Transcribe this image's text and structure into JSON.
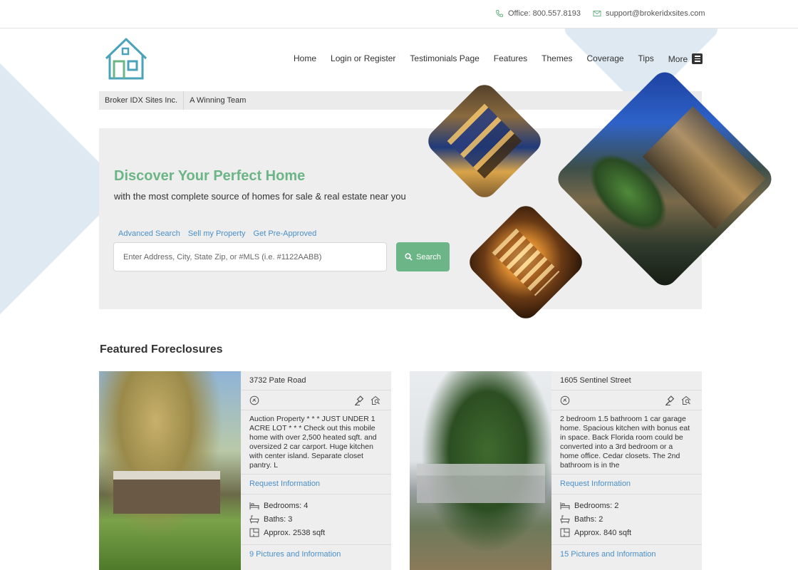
{
  "topbar": {
    "office": "Office: 800.557.8193",
    "email": "support@brokeridxsites.com"
  },
  "logo": {
    "icon": "house-logo-icon",
    "color": "#4aa3b8"
  },
  "nav": {
    "items": [
      "Home",
      "Login or Register",
      "Testimonials Page",
      "Features",
      "Themes",
      "Coverage",
      "Tips"
    ],
    "more": "More"
  },
  "crumbbar": {
    "company": "Broker IDX Sites Inc.",
    "tagline": "A Winning Team"
  },
  "hero": {
    "title": "Discover Your Perfect Home",
    "subtitle": "with the most complete source of homes for sale & real estate near you",
    "links": [
      "Advanced Search",
      "Sell my Property",
      "Get Pre-Approved"
    ],
    "search_placeholder": "Enter Address, City, State Zip, or #MLS (i.e. #1122AABB)",
    "search_button": "Search",
    "accent_color": "#6cb586"
  },
  "featured": {
    "title": "Featured Foreclosures",
    "listings": [
      {
        "address": "3732 Pate Road",
        "description": "Auction Property * * * JUST UNDER 1 ACRE LOT * * * Check out this mobile home with over 2,500 heated sqft. and oversized 2 car carport. Huge kitchen with center island. Separate closet pantry. L",
        "request": "Request Information",
        "bedrooms": "Bedrooms: 4",
        "baths": "Baths: 3",
        "sqft": "Approx. 2538 sqft",
        "pictures": "9 Pictures and Information"
      },
      {
        "address": "1605 Sentinel Street",
        "description": "2 bedroom 1.5 bathroom 1 car garage home. Spacious kitchen with bonus eat in space. Back Florida room could be converted into a 3rd bedroom or a home office. Cedar closets. The 2nd bathroom is in the",
        "request": "Request Information",
        "bedrooms": "Bedrooms: 2",
        "baths": "Baths: 2",
        "sqft": "Approx. 840 sqft",
        "pictures": "15 Pictures and Information"
      }
    ]
  }
}
